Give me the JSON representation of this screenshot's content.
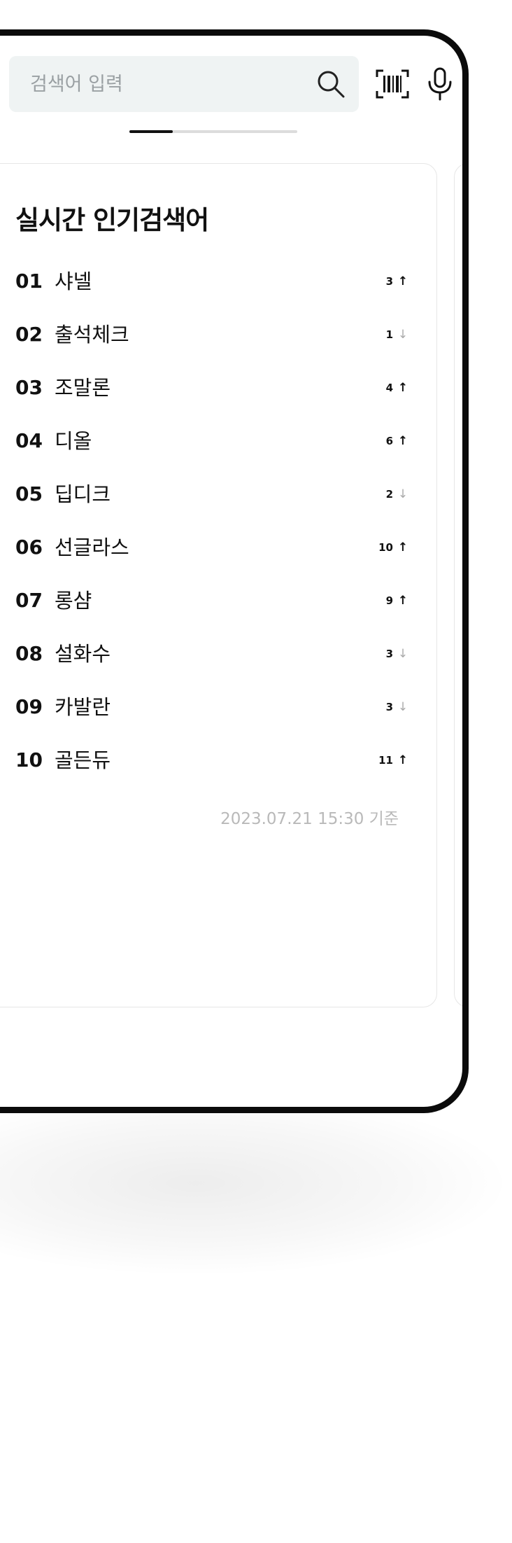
{
  "search": {
    "placeholder": "검색어 입력",
    "value": ""
  },
  "popular": {
    "title": "실시간 인기검색어",
    "items": [
      {
        "rank": "01",
        "keyword": "샤넬",
        "change": "3",
        "direction": "up"
      },
      {
        "rank": "02",
        "keyword": "출석체크",
        "change": "1",
        "direction": "down"
      },
      {
        "rank": "03",
        "keyword": "조말론",
        "change": "4",
        "direction": "up"
      },
      {
        "rank": "04",
        "keyword": "디올",
        "change": "6",
        "direction": "up"
      },
      {
        "rank": "05",
        "keyword": "딥디크",
        "change": "2",
        "direction": "down"
      },
      {
        "rank": "06",
        "keyword": "선글라스",
        "change": "10",
        "direction": "up"
      },
      {
        "rank": "07",
        "keyword": "롱샴",
        "change": "9",
        "direction": "up"
      },
      {
        "rank": "08",
        "keyword": "설화수",
        "change": "3",
        "direction": "down"
      },
      {
        "rank": "09",
        "keyword": "카발란",
        "change": "3",
        "direction": "down"
      },
      {
        "rank": "10",
        "keyword": "골든듀",
        "change": "11",
        "direction": "up"
      }
    ],
    "timestamp": "2023.07.21 15:30 기준"
  },
  "icons": {
    "search": "search-icon",
    "barcode": "barcode-scan-icon",
    "mic": "microphone-icon",
    "up": "arrow-up-icon",
    "down": "arrow-down-icon"
  },
  "pager": {
    "current": 1,
    "progress": 0.26
  }
}
